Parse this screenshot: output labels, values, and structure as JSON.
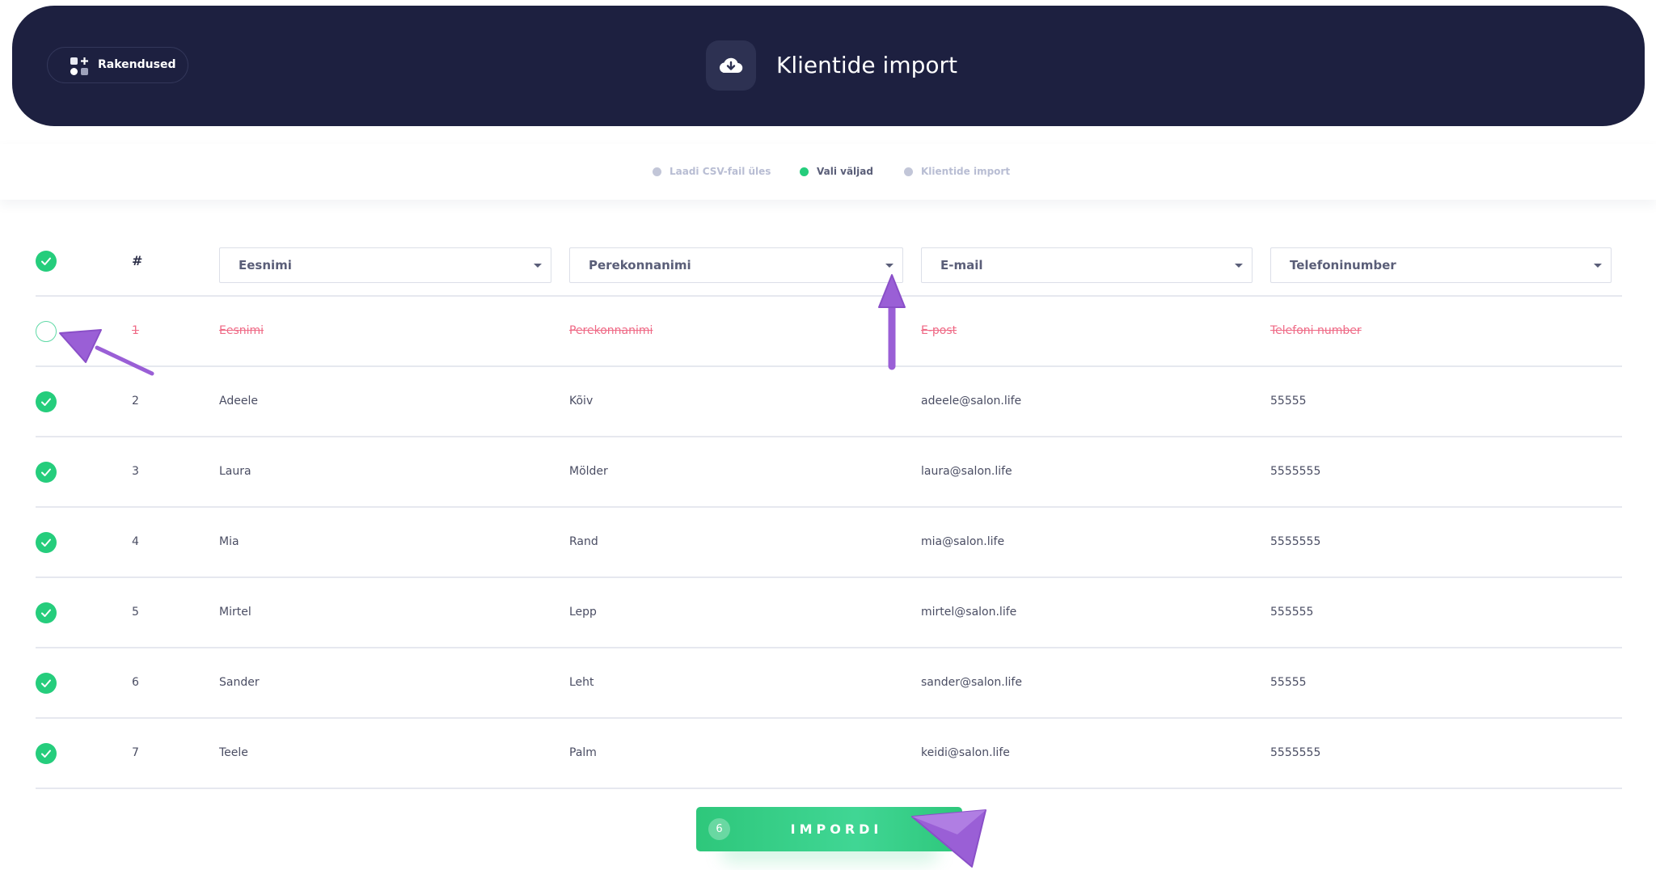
{
  "header": {
    "apps_button_label": "Rakendused",
    "title": "Klientide import"
  },
  "steps": [
    {
      "label": "Laadi CSV-fail üles",
      "state": "inactive"
    },
    {
      "label": "Vali väljad",
      "state": "active"
    },
    {
      "label": "Klientide import",
      "state": "inactive"
    }
  ],
  "table": {
    "hash_header": "#",
    "column_selects": [
      "Eesnimi",
      "Perekonnanimi",
      "E-mail",
      "Telefoninumber"
    ],
    "rows": [
      {
        "num": "1",
        "first": "Eesnimi",
        "last": "Perekonnanimi",
        "email": "E-post",
        "phone": "Telefoni number",
        "selected": false
      },
      {
        "num": "2",
        "first": "Adeele",
        "last": "Kõiv",
        "email": "adeele@salon.life",
        "phone": "55555",
        "selected": true
      },
      {
        "num": "3",
        "first": "Laura",
        "last": "Mölder",
        "email": "laura@salon.life",
        "phone": "5555555",
        "selected": true
      },
      {
        "num": "4",
        "first": "Mia",
        "last": "Rand",
        "email": "mia@salon.life",
        "phone": "5555555",
        "selected": true
      },
      {
        "num": "5",
        "first": "Mirtel",
        "last": "Lepp",
        "email": "mirtel@salon.life",
        "phone": "555555",
        "selected": true
      },
      {
        "num": "6",
        "first": "Sander",
        "last": "Leht",
        "email": "sander@salon.life",
        "phone": "55555",
        "selected": true
      },
      {
        "num": "7",
        "first": "Teele",
        "last": "Palm",
        "email": "keidi@salon.life",
        "phone": "5555555",
        "selected": true
      }
    ]
  },
  "import_button": {
    "count": "6",
    "label": "IMPORDI"
  },
  "colors": {
    "header_bg": "#1d2040",
    "accent_green": "#25cd7c",
    "skipped_red": "#ef6a86",
    "annotation_purple": "#9a5fd6"
  },
  "icons": [
    "grid-plus-icon",
    "cloud-download-icon",
    "check-icon",
    "chevron-down-icon"
  ]
}
